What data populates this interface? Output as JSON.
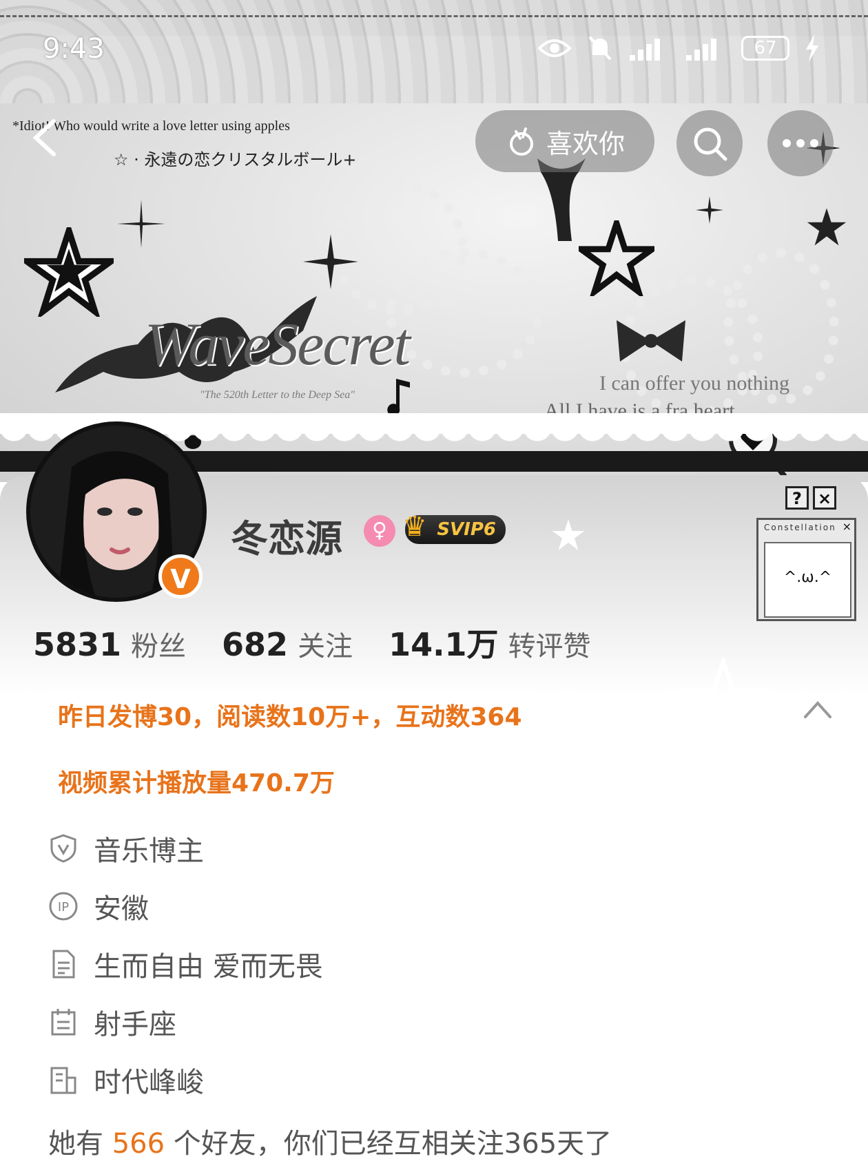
{
  "status_bar": {
    "time": "9:43",
    "battery": "67"
  },
  "banner": {
    "line1": "*Idiot! Who would write a love letter using apples",
    "line2": "☆ · 永遠の恋クリスタルボール+",
    "logo": "WaveSecret",
    "logo_sub": "\"The 520th Letter to the Deep Sea\"",
    "line3": "I can offer you nothing",
    "line4": "All I have is a fra      heart",
    "window_title": "Constellation"
  },
  "nav": {
    "like_label": "喜欢你",
    "icons": [
      "back-icon",
      "search-icon",
      "more-icon"
    ]
  },
  "profile": {
    "name": "冬恋源",
    "verified": "V",
    "gender": "♀",
    "svip": "SVIP6",
    "stats": [
      {
        "value": "5831",
        "label": "粉丝"
      },
      {
        "value": "682",
        "label": "关注"
      },
      {
        "value": "14.1万",
        "label": "转评赞"
      }
    ],
    "highlights": [
      "昨日发博30，阅读数10万+，互动数364",
      "视频累计播放量470.7万"
    ],
    "info": [
      {
        "icon": "verified-shield-icon",
        "text": "音乐博主"
      },
      {
        "icon": "ip-icon",
        "text": "安徽"
      },
      {
        "icon": "document-icon",
        "text": "生而自由 爱而无畏"
      },
      {
        "icon": "calendar-icon",
        "text": "射手座"
      },
      {
        "icon": "company-icon",
        "text": "时代峰峻"
      }
    ],
    "friends": {
      "prefix": "她有",
      "count": "566",
      "suffix": "个好友，你们已经互相关注365天了"
    },
    "constellation_window": {
      "title": "Constellation",
      "face": "^.ω.^",
      "help": "?",
      "close": "×"
    }
  },
  "colors": {
    "accent_orange": "#e8731a",
    "verified_orange": "#f07a1a",
    "gender_pink": "#f58bb0",
    "svip_gold": "#f6c343"
  }
}
